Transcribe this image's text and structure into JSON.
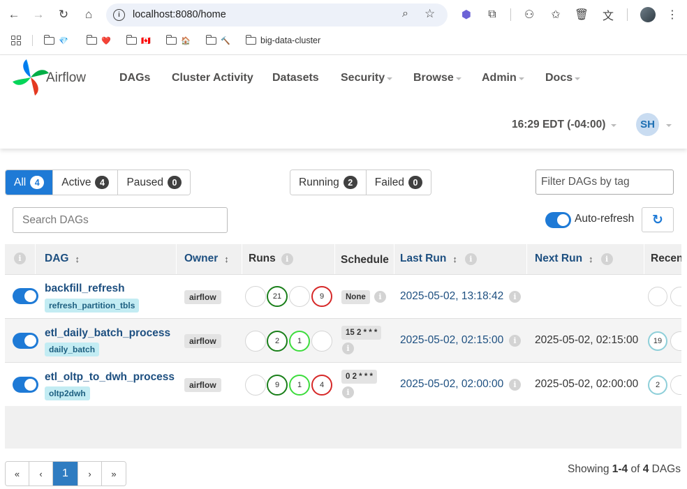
{
  "browser": {
    "url": "localhost:8080/home",
    "bookmarks": [
      {
        "label": "",
        "glyph": "💎"
      },
      {
        "label": "",
        "glyph": "❤️"
      },
      {
        "label": "",
        "glyph": "🇨🇦"
      },
      {
        "label": "",
        "glyph": "🏠"
      },
      {
        "label": "",
        "glyph": "🔨"
      },
      {
        "label": "big-data-cluster",
        "glyph": ""
      }
    ]
  },
  "navbar": {
    "brand": "Airflow",
    "items": [
      "DAGs",
      "Cluster Activity",
      "Datasets",
      "Security",
      "Browse",
      "Admin",
      "Docs"
    ],
    "clock": "16:29 EDT (-04:00)",
    "user_initials": "SH"
  },
  "filters": {
    "all_label": "All",
    "all_count": "4",
    "active_label": "Active",
    "active_count": "4",
    "paused_label": "Paused",
    "paused_count": "0",
    "running_label": "Running",
    "running_count": "2",
    "failed_label": "Failed",
    "failed_count": "0",
    "tag_placeholder": "Filter DAGs by tag",
    "search_placeholder": "Search DAGs",
    "autorefresh_label": "Auto-refresh"
  },
  "table": {
    "headers": {
      "dag": "DAG",
      "owner": "Owner",
      "runs": "Runs",
      "schedule": "Schedule",
      "last_run": "Last Run",
      "next_run": "Next Run",
      "recent": "Recen"
    },
    "rows": [
      {
        "name": "backfill_refresh",
        "tag": "refresh_partition_tbls",
        "owner": "airflow",
        "runs": [
          "",
          "21",
          "",
          "9"
        ],
        "schedule": "None",
        "last_run": "2025-05-02, 13:18:42",
        "next_run": "",
        "recent": ""
      },
      {
        "name": "etl_daily_batch_process",
        "tag": "daily_batch",
        "owner": "airflow",
        "runs": [
          "",
          "2",
          "1",
          ""
        ],
        "schedule": "15 2 * * *",
        "last_run": "2025-05-02, 02:15:00",
        "next_run": "2025-05-02, 02:15:00",
        "recent": "19"
      },
      {
        "name": "etl_oltp_to_dwh_process",
        "tag": "oltp2dwh",
        "owner": "airflow",
        "runs": [
          "",
          "9",
          "1",
          "4"
        ],
        "schedule": "0 2 * * *",
        "last_run": "2025-05-02, 02:00:00",
        "next_run": "2025-05-02, 02:00:00",
        "recent": "2"
      }
    ]
  },
  "pagination": {
    "first": "«",
    "prev": "‹",
    "current": "1",
    "next": "›",
    "last": "»",
    "showing_prefix": "Showing ",
    "showing_range": "1-4",
    "showing_mid": " of ",
    "showing_total": "4",
    "showing_suffix": " DAGs"
  },
  "colors": {
    "primary": "#1e7ad6",
    "run_success": "#1a7f1a",
    "run_running": "#3ddc3d",
    "run_failed": "#d62828",
    "queued_recent": "#8ecfd9"
  }
}
